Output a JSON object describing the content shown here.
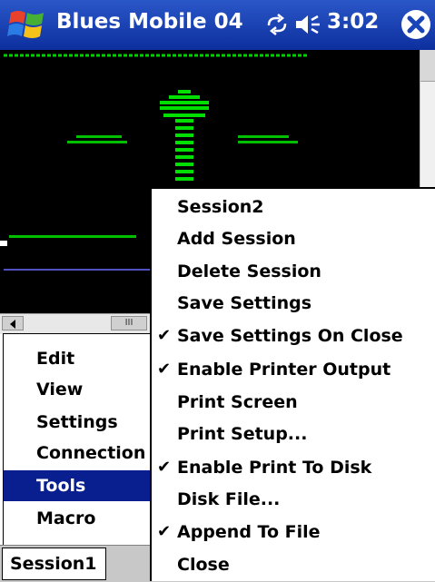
{
  "titlebar": {
    "app_title": "Blues Mobile 04",
    "clock": "3:02",
    "start_icon": "windows-flag-icon",
    "sync_icon": "sync-icon",
    "volume_icon": "volume-icon",
    "close_icon": "close-icon",
    "color": "#1a45b8"
  },
  "terminal": {
    "background": "#000000",
    "text_color": "#00e000"
  },
  "hscroll": {
    "thumb_label": "III"
  },
  "left_menu": {
    "items": [
      {
        "label": "Edit",
        "selected": false
      },
      {
        "label": "View",
        "selected": false
      },
      {
        "label": "Settings",
        "selected": false
      },
      {
        "label": "Connection",
        "selected": false
      },
      {
        "label": "Tools",
        "selected": true
      },
      {
        "label": "Macro",
        "selected": false
      }
    ],
    "selected_color": "#0a1f8f"
  },
  "tabbar": {
    "session_label": "Session1"
  },
  "submenu": {
    "check_glyph": "✔",
    "items": [
      {
        "label": "Session2",
        "checked": false
      },
      {
        "label": "Add Session",
        "checked": false
      },
      {
        "label": "Delete Session",
        "checked": false
      },
      {
        "label": "Save Settings",
        "checked": false
      },
      {
        "label": "Save Settings On Close",
        "checked": true
      },
      {
        "label": "Enable Printer Output",
        "checked": true
      },
      {
        "label": "Print Screen",
        "checked": false
      },
      {
        "label": "Print Setup...",
        "checked": false
      },
      {
        "label": "Enable Print To Disk",
        "checked": true
      },
      {
        "label": "Disk File...",
        "checked": false
      },
      {
        "label": "Append To File",
        "checked": true
      },
      {
        "label": "Close",
        "checked": false
      }
    ]
  }
}
